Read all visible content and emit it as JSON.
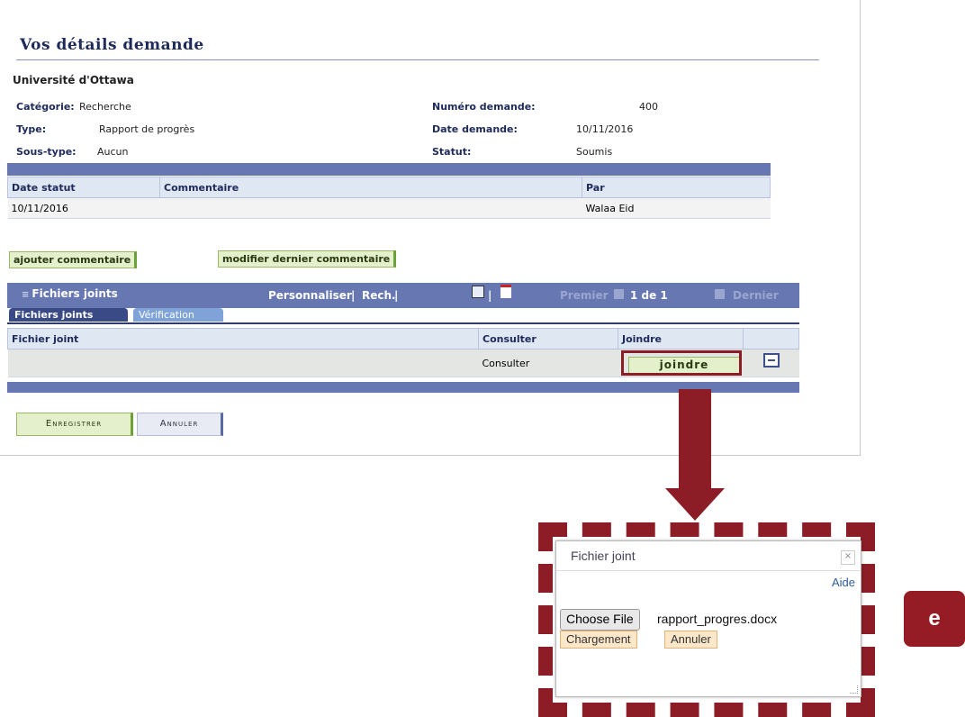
{
  "page": {
    "title": "Vos détails demande",
    "organization": "Université d'Ottawa"
  },
  "details": {
    "category_label": "Catégorie:",
    "category_value": "Recherche",
    "type_label": "Type:",
    "type_value": "Rapport de progrès",
    "subtype_label": "Sous-type:",
    "subtype_value": "Aucun",
    "request_number_label": "Numéro demande:",
    "request_number_value": "400",
    "request_date_label": "Date demande:",
    "request_date_value": "10/11/2016",
    "status_label": "Statut:",
    "status_value": "Soumis"
  },
  "status_table": {
    "headers": [
      "Date statut",
      "Commentaire",
      "Par"
    ],
    "rows": [
      [
        "10/11/2016",
        "",
        "Walaa Eid"
      ]
    ]
  },
  "comment_buttons": {
    "add": "ajouter commentaire",
    "edit": "modifier dernier commentaire"
  },
  "attachments": {
    "title": "Fichiers joints",
    "personalize": "Personnaliser",
    "search": "Rech.",
    "separator": "|",
    "first": "Premier",
    "pager": "1 de 1",
    "last": "Dernier",
    "tabs": [
      "Fichiers joints",
      "Vérification"
    ],
    "headers": [
      "Fichier joint",
      "Consulter",
      "Joindre"
    ],
    "row": {
      "file": "",
      "view": "Consulter",
      "attach": "joindre"
    }
  },
  "footer": {
    "save": "Enregistrer",
    "cancel": "Annuler"
  },
  "dialog": {
    "title": "Fichier joint",
    "close": "×",
    "help": "Aide",
    "choose_file": "Choose File",
    "filename": "rapport_progres.docx",
    "upload": "Chargement",
    "cancel": "Annuler"
  },
  "badge": {
    "letter": "e"
  },
  "colors": {
    "accent_red": "#8c1d26",
    "bar_blue": "#6777b2",
    "green_button": "#e3f0cb"
  }
}
